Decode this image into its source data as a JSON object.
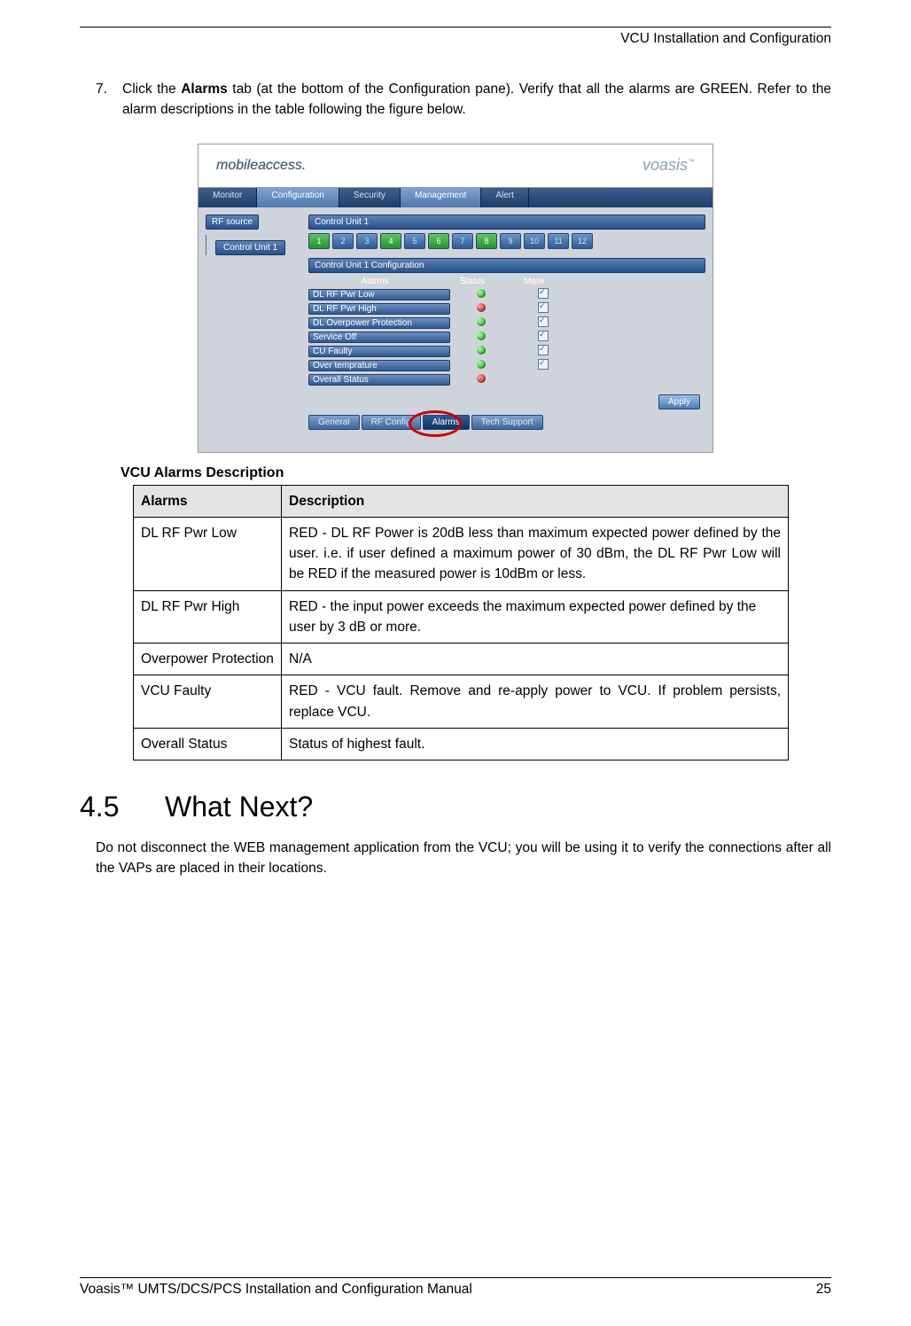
{
  "header": {
    "title": "VCU Installation and Configuration"
  },
  "step": {
    "num": "7.",
    "text_pre": "Click the ",
    "text_bold": "Alarms",
    "text_post": " tab (at the bottom of the Configuration pane). Verify that all the alarms are GREEN. Refer to the alarm descriptions in the table following the figure below."
  },
  "figure": {
    "brand_left": "mobileaccess.",
    "brand_right": "voasis",
    "brand_tm": "™",
    "nav": {
      "monitor": "Monitor",
      "configuration": "Configuration",
      "security": "Security",
      "management": "Management",
      "alert": "Alert"
    },
    "sidebar": {
      "rf_source": "RF source",
      "control_unit": "Control Unit 1"
    },
    "panel_control_unit": "Control Unit 1",
    "cfg_title": "Control Unit 1 Configuration",
    "chips": [
      "1",
      "2",
      "3",
      "4",
      "5",
      "6",
      "7",
      "8",
      "9",
      "10",
      "11",
      "12"
    ],
    "chip_green": [
      1,
      4,
      6,
      8
    ],
    "col_heads": {
      "alarms": "Alarms",
      "status": "Status",
      "mask": "Mask"
    },
    "alarm_rows": [
      {
        "name": "DL RF Pwr Low",
        "status": "green",
        "mask": true
      },
      {
        "name": "DL RF Pwr High",
        "status": "red",
        "mask": true
      },
      {
        "name": "DL Overpower Protection",
        "status": "green",
        "mask": true
      },
      {
        "name": "Service Off",
        "status": "green",
        "mask": true
      },
      {
        "name": "CU Faulty",
        "status": "green",
        "mask": true
      },
      {
        "name": "Over temprature",
        "status": "green",
        "mask": true
      },
      {
        "name": "Overall Status",
        "status": "red",
        "mask": false
      }
    ],
    "apply": "Apply",
    "btabs": {
      "general": "General",
      "rf_config": "RF Config",
      "alarms": "Alarms",
      "tech_support": "Tech Support"
    }
  },
  "table": {
    "title": "VCU Alarms Description",
    "head": {
      "alarms": "Alarms",
      "description": "Description"
    },
    "rows": [
      {
        "alarm": "DL RF Pwr Low",
        "desc": "RED - DL RF Power is 20dB less than maximum expected power defined by the user. i.e. if user defined a maximum power of 30 dBm, the DL RF Pwr Low will be RED if the measured power is 10dBm or less."
      },
      {
        "alarm": "DL RF Pwr High",
        "desc": "RED - the input power exceeds the maximum expected power defined by the user by 3 dB or more."
      },
      {
        "alarm": "Overpower Protection",
        "desc": "N/A"
      },
      {
        "alarm": "VCU Faulty",
        "desc": "RED - VCU fault. Remove and re-apply power to VCU. If problem persists, replace VCU."
      },
      {
        "alarm": "Overall Status",
        "desc": "Status of highest fault."
      }
    ]
  },
  "section": {
    "num": "4.5",
    "title": "What Next?"
  },
  "section_body": "Do not disconnect the WEB management application from the VCU; you will be using it to verify the connections after all the VAPs are placed in their locations.",
  "footer": {
    "left": "Voasis™ UMTS/DCS/PCS Installation and Configuration Manual",
    "right": "25"
  }
}
